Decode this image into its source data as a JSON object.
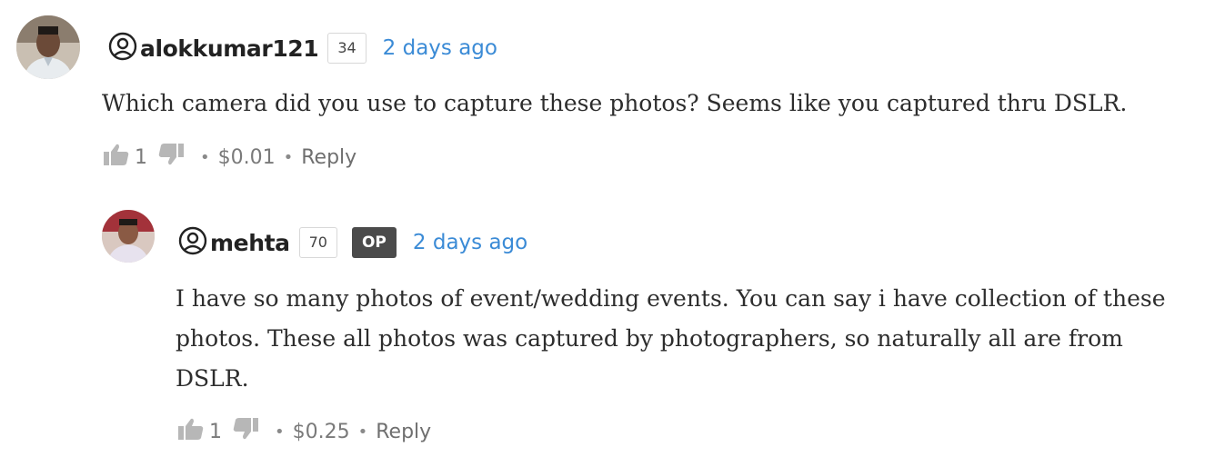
{
  "comments": [
    {
      "username": "alokkumar121",
      "reputation": "34",
      "time": "2 days ago",
      "body": "Which camera did you use to capture these photos? Seems like you captured thru DSLR.",
      "votes": "1",
      "payout": "$0.01",
      "reply_label": "Reply",
      "is_op": false
    },
    {
      "username": "mehta",
      "reputation": "70",
      "op_label": "OP",
      "time": "2 days ago",
      "body": "I have so many photos of event/wedding events. You can say i have collection of these photos. These all photos was captured by photographers, so naturally all are from DSLR.",
      "votes": "1",
      "payout": "$0.25",
      "reply_label": "Reply",
      "is_op": true
    }
  ],
  "colors": {
    "link": "#3b8bd6",
    "op_badge": "#4b4b4b",
    "muted": "#7a7a7a"
  },
  "icons": [
    "user-avatar",
    "at-icon",
    "thumbs-up-icon",
    "thumbs-down-icon"
  ]
}
